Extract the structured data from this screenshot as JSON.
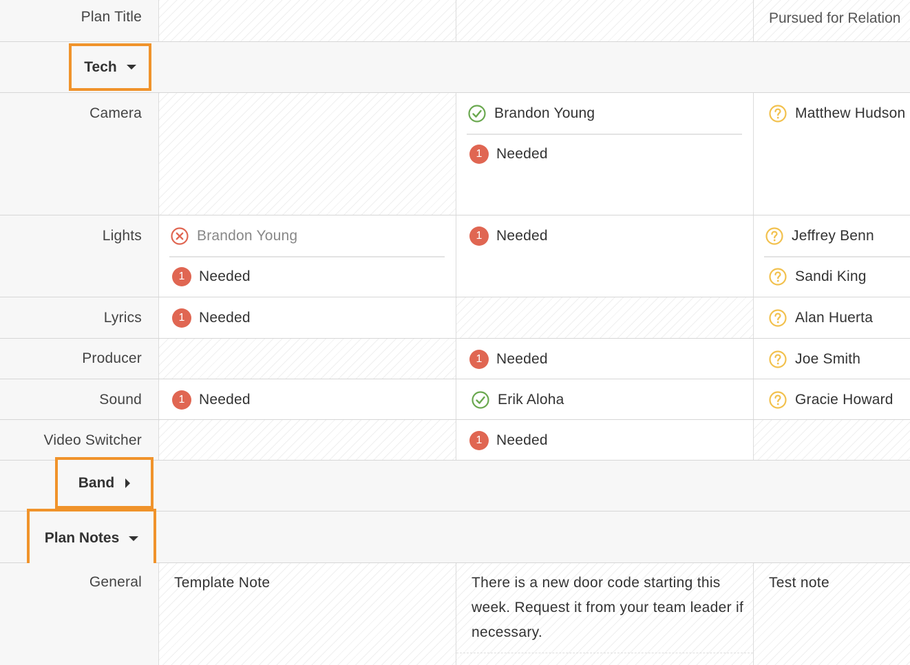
{
  "header": {
    "label": "Plan Title",
    "col3_title": "Pursued for Relation"
  },
  "sections": {
    "tech": {
      "label": "Tech"
    },
    "band": {
      "label": "Band"
    },
    "plan_notes": {
      "label": "Plan Notes"
    }
  },
  "rows": {
    "camera": {
      "label": "Camera",
      "col2": [
        {
          "status": "confirmed",
          "name": "Brandon Young"
        },
        {
          "status": "needed",
          "count": "1",
          "name": "Needed"
        }
      ],
      "col3": [
        {
          "status": "unconfirmed",
          "name": "Matthew Hudson"
        }
      ]
    },
    "lights": {
      "label": "Lights",
      "col1": [
        {
          "status": "declined",
          "name": "Brandon Young"
        },
        {
          "status": "needed",
          "count": "1",
          "name": "Needed"
        }
      ],
      "col2": [
        {
          "status": "needed",
          "count": "1",
          "name": "Needed"
        }
      ],
      "col3": [
        {
          "status": "unconfirmed",
          "name": "Jeffrey Benn"
        },
        {
          "status": "unconfirmed",
          "name": "Sandi King"
        }
      ]
    },
    "lyrics": {
      "label": "Lyrics",
      "col1": [
        {
          "status": "needed",
          "count": "1",
          "name": "Needed"
        }
      ],
      "col3": [
        {
          "status": "unconfirmed",
          "name": "Alan Huerta"
        }
      ]
    },
    "producer": {
      "label": "Producer",
      "col2": [
        {
          "status": "needed",
          "count": "1",
          "name": "Needed"
        }
      ],
      "col3": [
        {
          "status": "unconfirmed",
          "name": "Joe Smith"
        }
      ]
    },
    "sound": {
      "label": "Sound",
      "col1": [
        {
          "status": "needed",
          "count": "1",
          "name": "Needed"
        }
      ],
      "col2": [
        {
          "status": "confirmed",
          "name": "Erik Aloha"
        }
      ],
      "col3": [
        {
          "status": "unconfirmed",
          "name": "Gracie Howard"
        }
      ]
    },
    "video_switcher": {
      "label": "Video Switcher",
      "col2": [
        {
          "status": "needed",
          "count": "1",
          "name": "Needed"
        }
      ]
    },
    "general": {
      "label": "General",
      "col1_note": "Template Note",
      "col2_note": "There is a new door code starting this week. Request it from your team leader if necessary.",
      "col3_note": "Test note"
    }
  },
  "colors": {
    "highlight": "#f0932b",
    "needed": "#e06652",
    "confirmed": "#6aa84f",
    "unconfirmed": "#f2c14e",
    "declined": "#e06652"
  },
  "icons": {
    "confirmed": "check-circle-icon",
    "unconfirmed": "question-circle-icon",
    "declined": "x-circle-icon",
    "needed": "needed-count-badge",
    "caret_down": "caret-down-icon",
    "caret_right": "caret-right-icon"
  }
}
